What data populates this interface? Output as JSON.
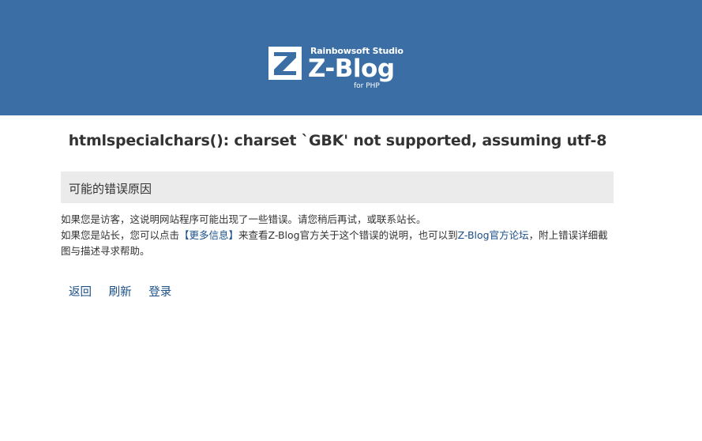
{
  "header": {
    "studio": "Rainbowsoft Studio",
    "name": "Z-Blog",
    "subtitle": "for PHP",
    "background_color": "#3a6ea5"
  },
  "error": {
    "title": "htmlspecialchars(): charset `GBK' not supported, assuming utf-8"
  },
  "reason": {
    "heading": "可能的错误原因"
  },
  "description": {
    "line1": "如果您是访客，这说明网站程序可能出现了一些错误。请您稍后再试，或联系站长。",
    "line2_prefix": "如果您是站长，您可以点击",
    "more_info_link": "【更多信息】",
    "line2_middle": "来查看Z-Blog官方关于这个错误的说明，也可以到",
    "forum_link": "Z-Blog官方论坛",
    "line2_suffix": "，附上错误详细截图与描述寻求帮助。"
  },
  "nav": {
    "back": "返回",
    "refresh": "刷新",
    "login": "登录"
  },
  "colors": {
    "link": "#1a4f8a",
    "reason_background": "#ebebeb"
  }
}
